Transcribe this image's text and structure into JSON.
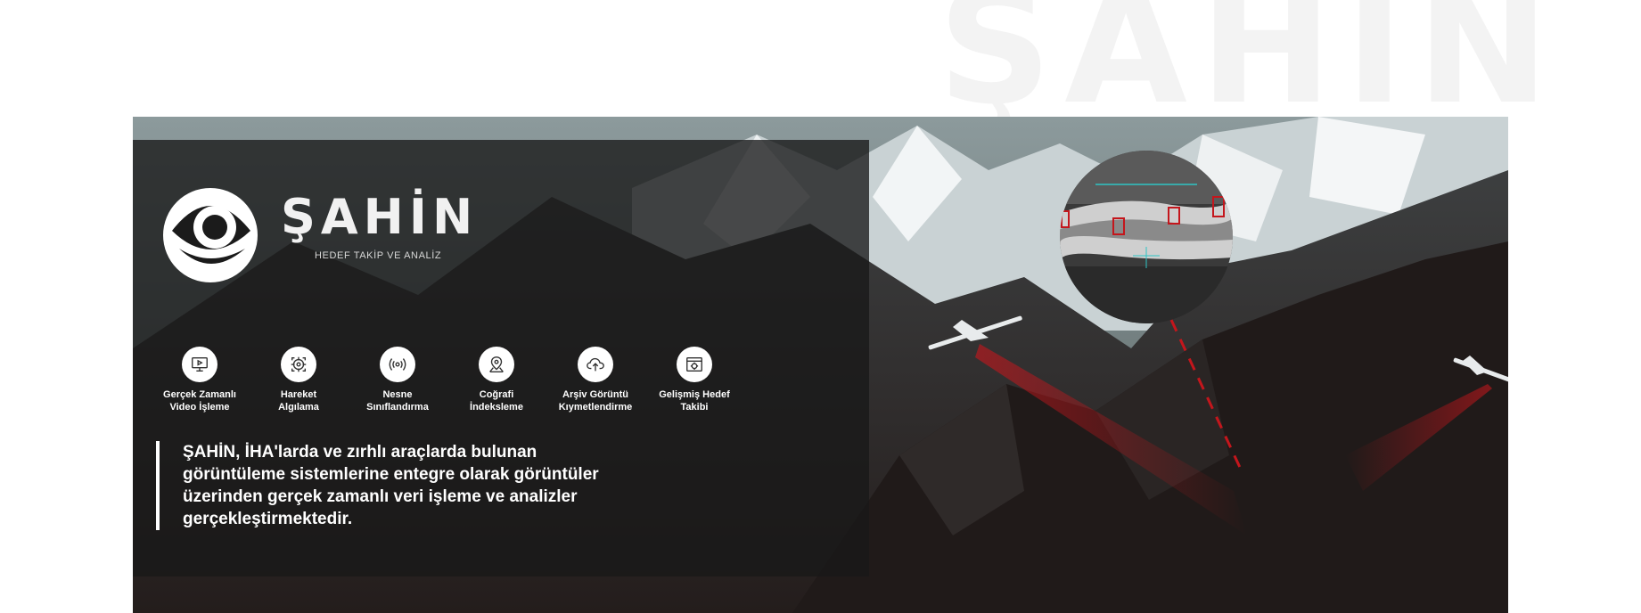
{
  "watermark": {
    "text": "ŞAHİN"
  },
  "brand": {
    "name": "ŞAHİN",
    "tagline": "HEDEF TAKİP VE ANALİZ"
  },
  "features": [
    {
      "label": "Gerçek Zamanlı\nVideo İşleme",
      "icon": "monitor-play-icon"
    },
    {
      "label": "Hareket\nAlgılama",
      "icon": "target-crosshair-icon"
    },
    {
      "label": "Nesne\nSınıflandırma",
      "icon": "broadcast-signal-icon"
    },
    {
      "label": "Coğrafi\nİndeksleme",
      "icon": "map-pin-icon"
    },
    {
      "label": "Arşiv Görüntü\nKıymetlendirme",
      "icon": "cloud-upload-icon"
    },
    {
      "label": "Gelişmiş Hedef\nTakibi",
      "icon": "browser-gear-icon"
    }
  ],
  "description": "ŞAHİN, İHA'larda ve zırhlı araçlarda bulunan görüntüleme sistemlerine entegre olarak görüntüler üzerinden gerçek zamanlı veri işleme ve analizler gerçekleştirmektedir.",
  "colors": {
    "accent": "#c4161c",
    "hud": "#2ec4c4",
    "panel": "#181818",
    "text": "#ffffff"
  }
}
